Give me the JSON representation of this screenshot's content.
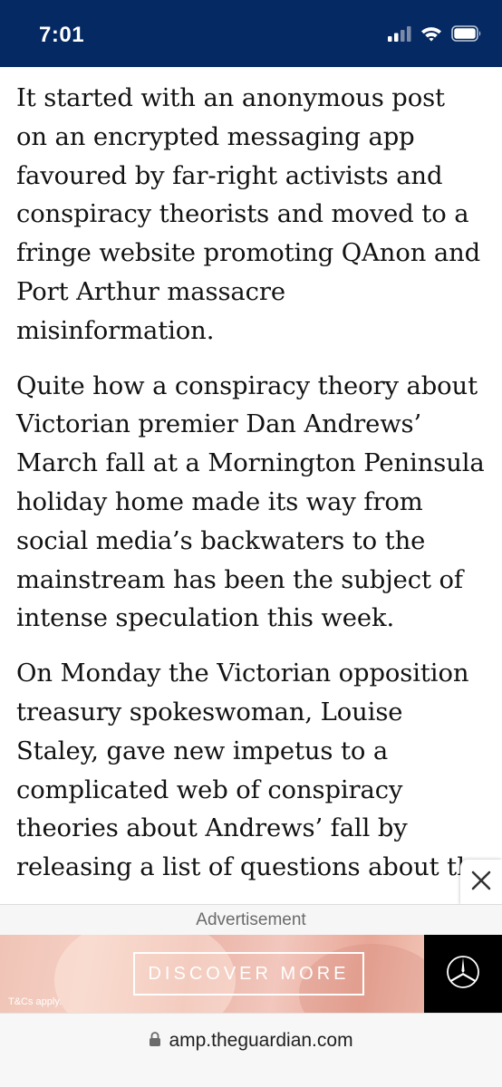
{
  "status_bar": {
    "time": "7:01",
    "icons": [
      "signal-icon",
      "wifi-icon",
      "battery-icon"
    ],
    "background": "#052962"
  },
  "article": {
    "paragraphs": [
      {
        "lines": [
          "It started with an anonymous post",
          "on an encrypted messaging app",
          "favoured by far-right activists and",
          "conspiracy theorists and moved to a",
          "fringe website promoting QAnon and",
          "Port Arthur massacre",
          "misinformation."
        ]
      },
      {
        "lines": [
          "Quite how a conspiracy theory about",
          "Victorian premier Dan Andrews’",
          "March fall at a Mornington Peninsula",
          "holiday home made its way from",
          "social media’s backwaters to the",
          "mainstream has been the subject of",
          "intense speculation this week."
        ]
      },
      {
        "lines": [
          "On Monday the Victorian opposition",
          "treasury spokeswoman, Louise",
          "Staley, gave new impetus to a",
          "complicated web of conspiracy",
          "theories about Andrews’ fall by",
          "releasing a list of questions about th"
        ]
      }
    ]
  },
  "ad": {
    "close_icon": "close-icon",
    "label": "Advertisement",
    "button_label": "DISCOVER MORE",
    "terms": "T&Cs apply.",
    "brand_icon": "mercedes-star-icon"
  },
  "browser": {
    "lock_icon": "lock-icon",
    "url": "amp.theguardian.com"
  }
}
